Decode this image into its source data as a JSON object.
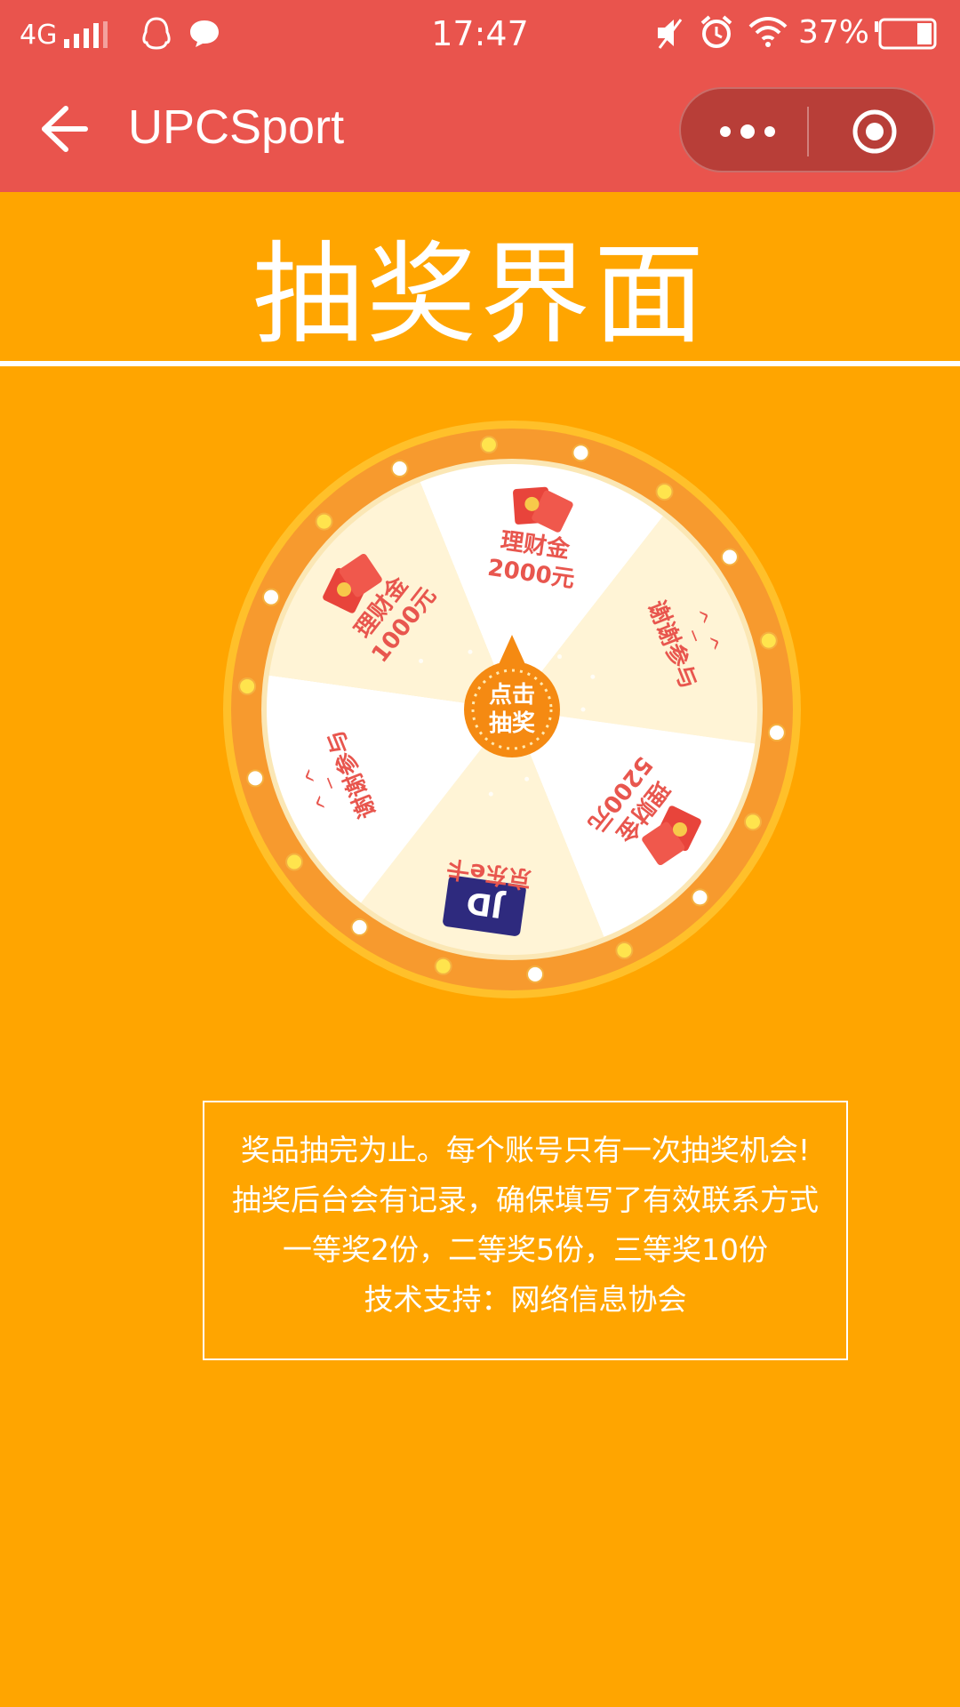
{
  "statusbar": {
    "network": "4G",
    "time": "17:47",
    "battery_percent": "37%",
    "icons": [
      "signal-bars-icon",
      "qq-icon",
      "chat-bubble-icon",
      "mute-icon",
      "alarm-icon",
      "wifi-icon",
      "battery-icon"
    ]
  },
  "navbar": {
    "title": "UPCSport",
    "icons": [
      "back-arrow-icon",
      "more-dots-icon",
      "close-target-icon"
    ]
  },
  "page": {
    "title": "抽奖界面"
  },
  "wheel": {
    "center_button": [
      "点击",
      "抽奖"
    ],
    "segments": [
      {
        "lines": [
          "理财金",
          "2000元"
        ],
        "icon": "red-envelope-icon"
      },
      {
        "lines": [
          "谢谢参与"
        ],
        "emoticon": "^_^"
      },
      {
        "lines": [
          "理财金",
          "5200元"
        ],
        "icon": "red-envelope-icon"
      },
      {
        "lines": [
          "京东e卡"
        ],
        "icon": "jd-card-icon"
      },
      {
        "lines": [
          "谢谢参与"
        ],
        "emoticon": "^_^"
      },
      {
        "lines": [
          "理财金",
          "1000元"
        ],
        "icon": "red-envelope-icon"
      }
    ],
    "colors": {
      "segment_light": "#FFFFFF",
      "segment_cream": "#FFF4D6",
      "rim": "#F79A2E",
      "text": "#E8564E",
      "pointer": "#F58A12"
    }
  },
  "notice": {
    "lines": [
      "奖品抽完为止。每个账号只有一次抽奖机会!",
      "抽奖后台会有记录，确保填写了有效联系方式",
      "一等奖2份，二等奖5份，三等奖10份",
      "技术支持：网络信息协会"
    ]
  }
}
